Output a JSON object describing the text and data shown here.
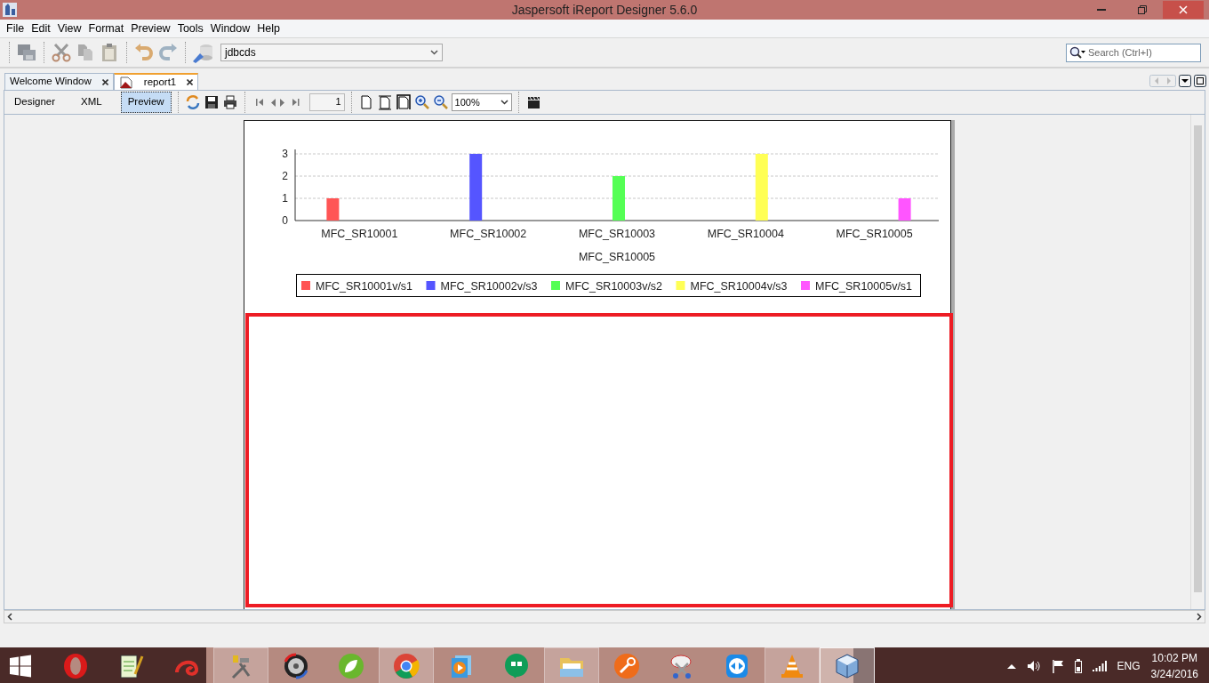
{
  "window": {
    "title": "Jaspersoft iReport Designer 5.6.0"
  },
  "menu": [
    "File",
    "Edit",
    "View",
    "Format",
    "Preview",
    "Tools",
    "Window",
    "Help"
  ],
  "toolbar": {
    "datasource": "jdbcds",
    "search": {
      "placeholder": "Search (Ctrl+I)"
    }
  },
  "tabs": [
    {
      "label": "Welcome Window",
      "selected": false
    },
    {
      "label": "report1",
      "selected": true
    }
  ],
  "view_modes": [
    {
      "label": "Designer",
      "selected": false
    },
    {
      "label": "XML",
      "selected": false
    },
    {
      "label": "Preview",
      "selected": true
    }
  ],
  "preview_toolbar": {
    "page": "1",
    "zoom": "100%"
  },
  "report": {
    "chart": {
      "chart_data": {
        "type": "bar",
        "xlabel": "MFC_SR10005",
        "categories": [
          "MFC_SR10001",
          "MFC_SR10002",
          "MFC_SR10003",
          "MFC_SR10004",
          "MFC_SR10005"
        ],
        "grid": true,
        "legend": true,
        "ylim": [
          0,
          3.2
        ],
        "yticks": [
          0,
          1,
          2,
          3
        ],
        "series": [
          {
            "name": "MFC_SR10001v/s1",
            "color": "#ff5555",
            "values": [
              1,
              null,
              null,
              null,
              null
            ]
          },
          {
            "name": "MFC_SR10002v/s3",
            "color": "#5555ff",
            "values": [
              null,
              3,
              null,
              null,
              null
            ]
          },
          {
            "name": "MFC_SR10003v/s2",
            "color": "#55ff55",
            "values": [
              null,
              null,
              2,
              null,
              null
            ]
          },
          {
            "name": "MFC_SR10004v/s3",
            "color": "#ffff55",
            "values": [
              null,
              null,
              null,
              3,
              null
            ]
          },
          {
            "name": "MFC_SR10005v/s1",
            "color": "#ff55ff",
            "values": [
              null,
              null,
              null,
              null,
              1
            ]
          }
        ]
      }
    }
  },
  "taskbar": {
    "items": [
      {
        "open": false,
        "selected": false
      },
      {
        "open": false,
        "selected": false
      },
      {
        "open": false,
        "selected": false
      },
      {
        "open": true,
        "selected": false
      },
      {
        "open": false,
        "selected": false
      },
      {
        "open": false,
        "selected": false
      },
      {
        "open": true,
        "selected": false
      },
      {
        "open": false,
        "selected": false
      },
      {
        "open": false,
        "selected": false
      },
      {
        "open": true,
        "selected": false
      },
      {
        "open": false,
        "selected": false
      },
      {
        "open": false,
        "selected": false
      },
      {
        "open": false,
        "selected": false
      },
      {
        "open": true,
        "selected": false
      },
      {
        "open": true,
        "selected": true
      }
    ],
    "language": "ENG",
    "time": "10:02 PM",
    "date": "3/24/2016"
  }
}
